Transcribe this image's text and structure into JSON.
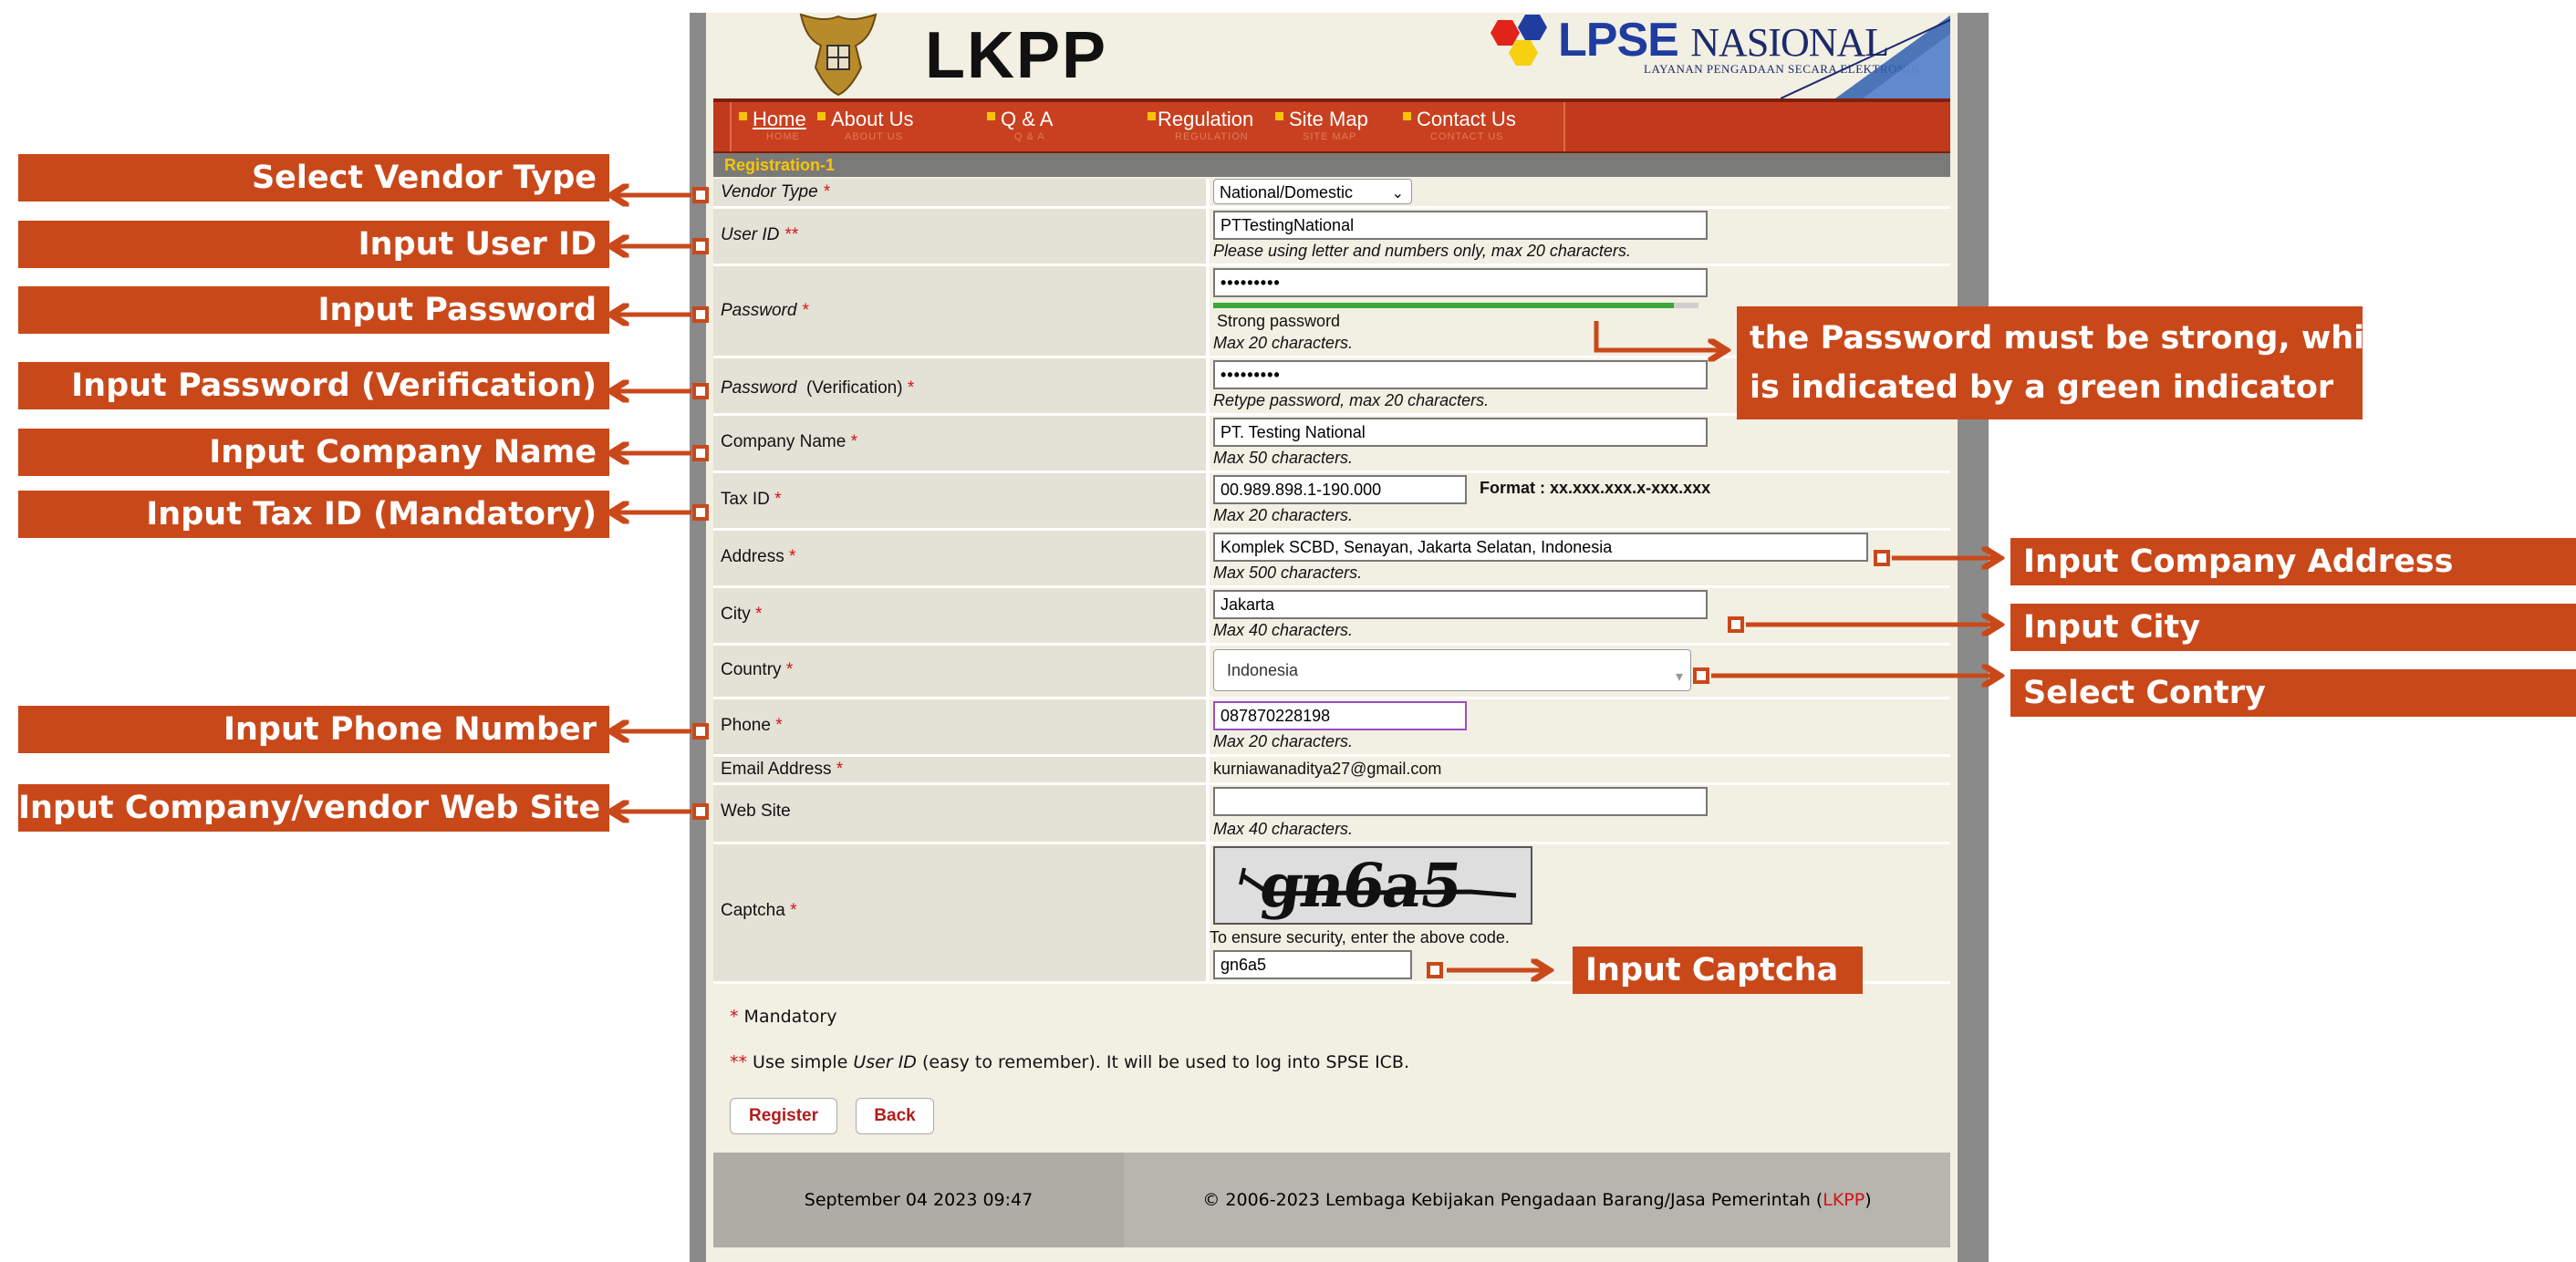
{
  "header": {
    "logo_left": "LKPP",
    "logo_right_main": "LPSE",
    "logo_right_accent": "NASIONAL",
    "logo_right_sub": "LAYANAN PENGADAAN SECARA ELEKTRONIK"
  },
  "nav": [
    {
      "label": "Home",
      "sub": "HOME"
    },
    {
      "label": "About Us",
      "sub": "ABOUT US"
    },
    {
      "label": "Q & A",
      "sub": "Q & A"
    },
    {
      "label": "Regulation",
      "sub": "REGULATION"
    },
    {
      "label": "Site Map",
      "sub": "SITE MAP"
    },
    {
      "label": "Contact Us",
      "sub": "CONTACT US"
    }
  ],
  "section_title": "Registration-1",
  "form": {
    "vendor_type": {
      "label": "Vendor Type",
      "value": "National/Domestic"
    },
    "user_id": {
      "label": "User ID",
      "value": "PTTestingNational",
      "hint": "Please using letter and numbers only, max 20 characters."
    },
    "password": {
      "label": "Password",
      "value": "•••••••••",
      "strength": "Strong password",
      "strength_level": 0.95,
      "hint": "Max 20 characters."
    },
    "password_verify": {
      "label": "Password",
      "label_suffix": "(Verification)",
      "value": "•••••••••",
      "hint": "Retype password, max 20 characters."
    },
    "company_name": {
      "label": "Company Name",
      "value": "PT. Testing National",
      "hint": "Max 50 characters."
    },
    "tax_id": {
      "label": "Tax ID",
      "value": "00.989.898.1-190.000",
      "format": "Format : xx.xxx.xxx.x-xxx.xxx",
      "hint": "Max 20 characters."
    },
    "address": {
      "label": "Address",
      "value": "Komplek SCBD, Senayan, Jakarta Selatan, Indonesia",
      "hint": "Max 500 characters."
    },
    "city": {
      "label": "City",
      "value": "Jakarta",
      "hint": "Max 40 characters."
    },
    "country": {
      "label": "Country",
      "value": "Indonesia"
    },
    "phone": {
      "label": "Phone",
      "value": "087870228198",
      "hint": "Max 20 characters."
    },
    "email": {
      "label": "Email Address",
      "value": "kurniawanaditya27@gmail.com"
    },
    "website": {
      "label": "Web Site",
      "value": "",
      "hint": "Max 40 characters."
    },
    "captcha": {
      "label": "Captcha",
      "image_text": "gn6a5",
      "hint": "To ensure security, enter the above code.",
      "value": "gn6a5"
    }
  },
  "notes": {
    "mandatory_mark": "*",
    "mandatory": "Mandatory",
    "simple_mark": "**",
    "simple_pre": "Use simple ",
    "simple_em": "User ID",
    "simple_post": " (easy to remember). It will be used to log into SPSE ICB."
  },
  "buttons": {
    "register": "Register",
    "back": "Back"
  },
  "footer": {
    "datetime": "September 04 2023 09:47",
    "copyright_pre": "© 2006-2023 Lembaga Kebijakan Pengadaan Barang/Jasa Pemerintah (",
    "copyright_link": "LKPP",
    "copyright_post": ")"
  },
  "callouts": {
    "vendor_type": "Select Vendor Type",
    "user_id": "Input User ID",
    "password": "Input Password",
    "password_verify": "Input Password (Verification)",
    "company_name": "Input Company Name",
    "tax_id": "Input Tax ID (Mandatory)",
    "phone": "Input Phone Number",
    "website": "Input Company/vendor Web Site",
    "password_note_line1": "the Password must be strong, which",
    "password_note_line2": "is indicated by a green indicator",
    "address": "Input Company Address",
    "city": "Input City",
    "country": "Select Contry",
    "captcha": "Input Captcha"
  },
  "colors": {
    "callout": "#c9481a",
    "nav": "#c23a1c",
    "strength": "#3aa83a",
    "required": "#d0141a"
  }
}
